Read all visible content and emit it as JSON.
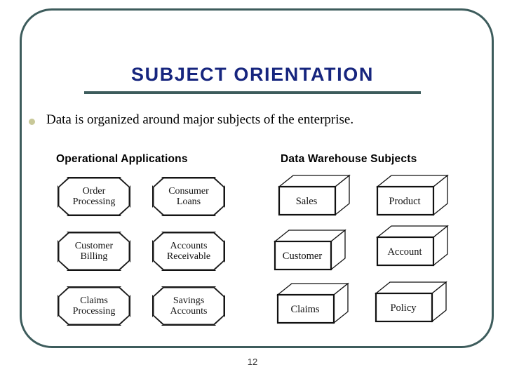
{
  "slide": {
    "title": "SUBJECT ORIENTATION",
    "page_number": "12",
    "title_color": "#16257e",
    "frame_color": "#3d5c5c",
    "bullet_color": "#c8c898",
    "bullets": [
      {
        "text": "Data is organized around major subjects of the enterprise."
      }
    ]
  },
  "diagram": {
    "headings": {
      "left": "Operational Applications",
      "right": "Data Warehouse Subjects"
    },
    "operational_applications": [
      {
        "label": "Order\nProcessing"
      },
      {
        "label": "Consumer\nLoans"
      },
      {
        "label": "Customer\nBilling"
      },
      {
        "label": "Accounts\nReceivable"
      },
      {
        "label": "Claims\nProcessing"
      },
      {
        "label": "Savings\nAccounts"
      }
    ],
    "data_warehouse_subjects": [
      {
        "label": "Sales"
      },
      {
        "label": "Product"
      },
      {
        "label": "Customer"
      },
      {
        "label": "Account"
      },
      {
        "label": "Claims"
      },
      {
        "label": "Policy"
      }
    ]
  }
}
